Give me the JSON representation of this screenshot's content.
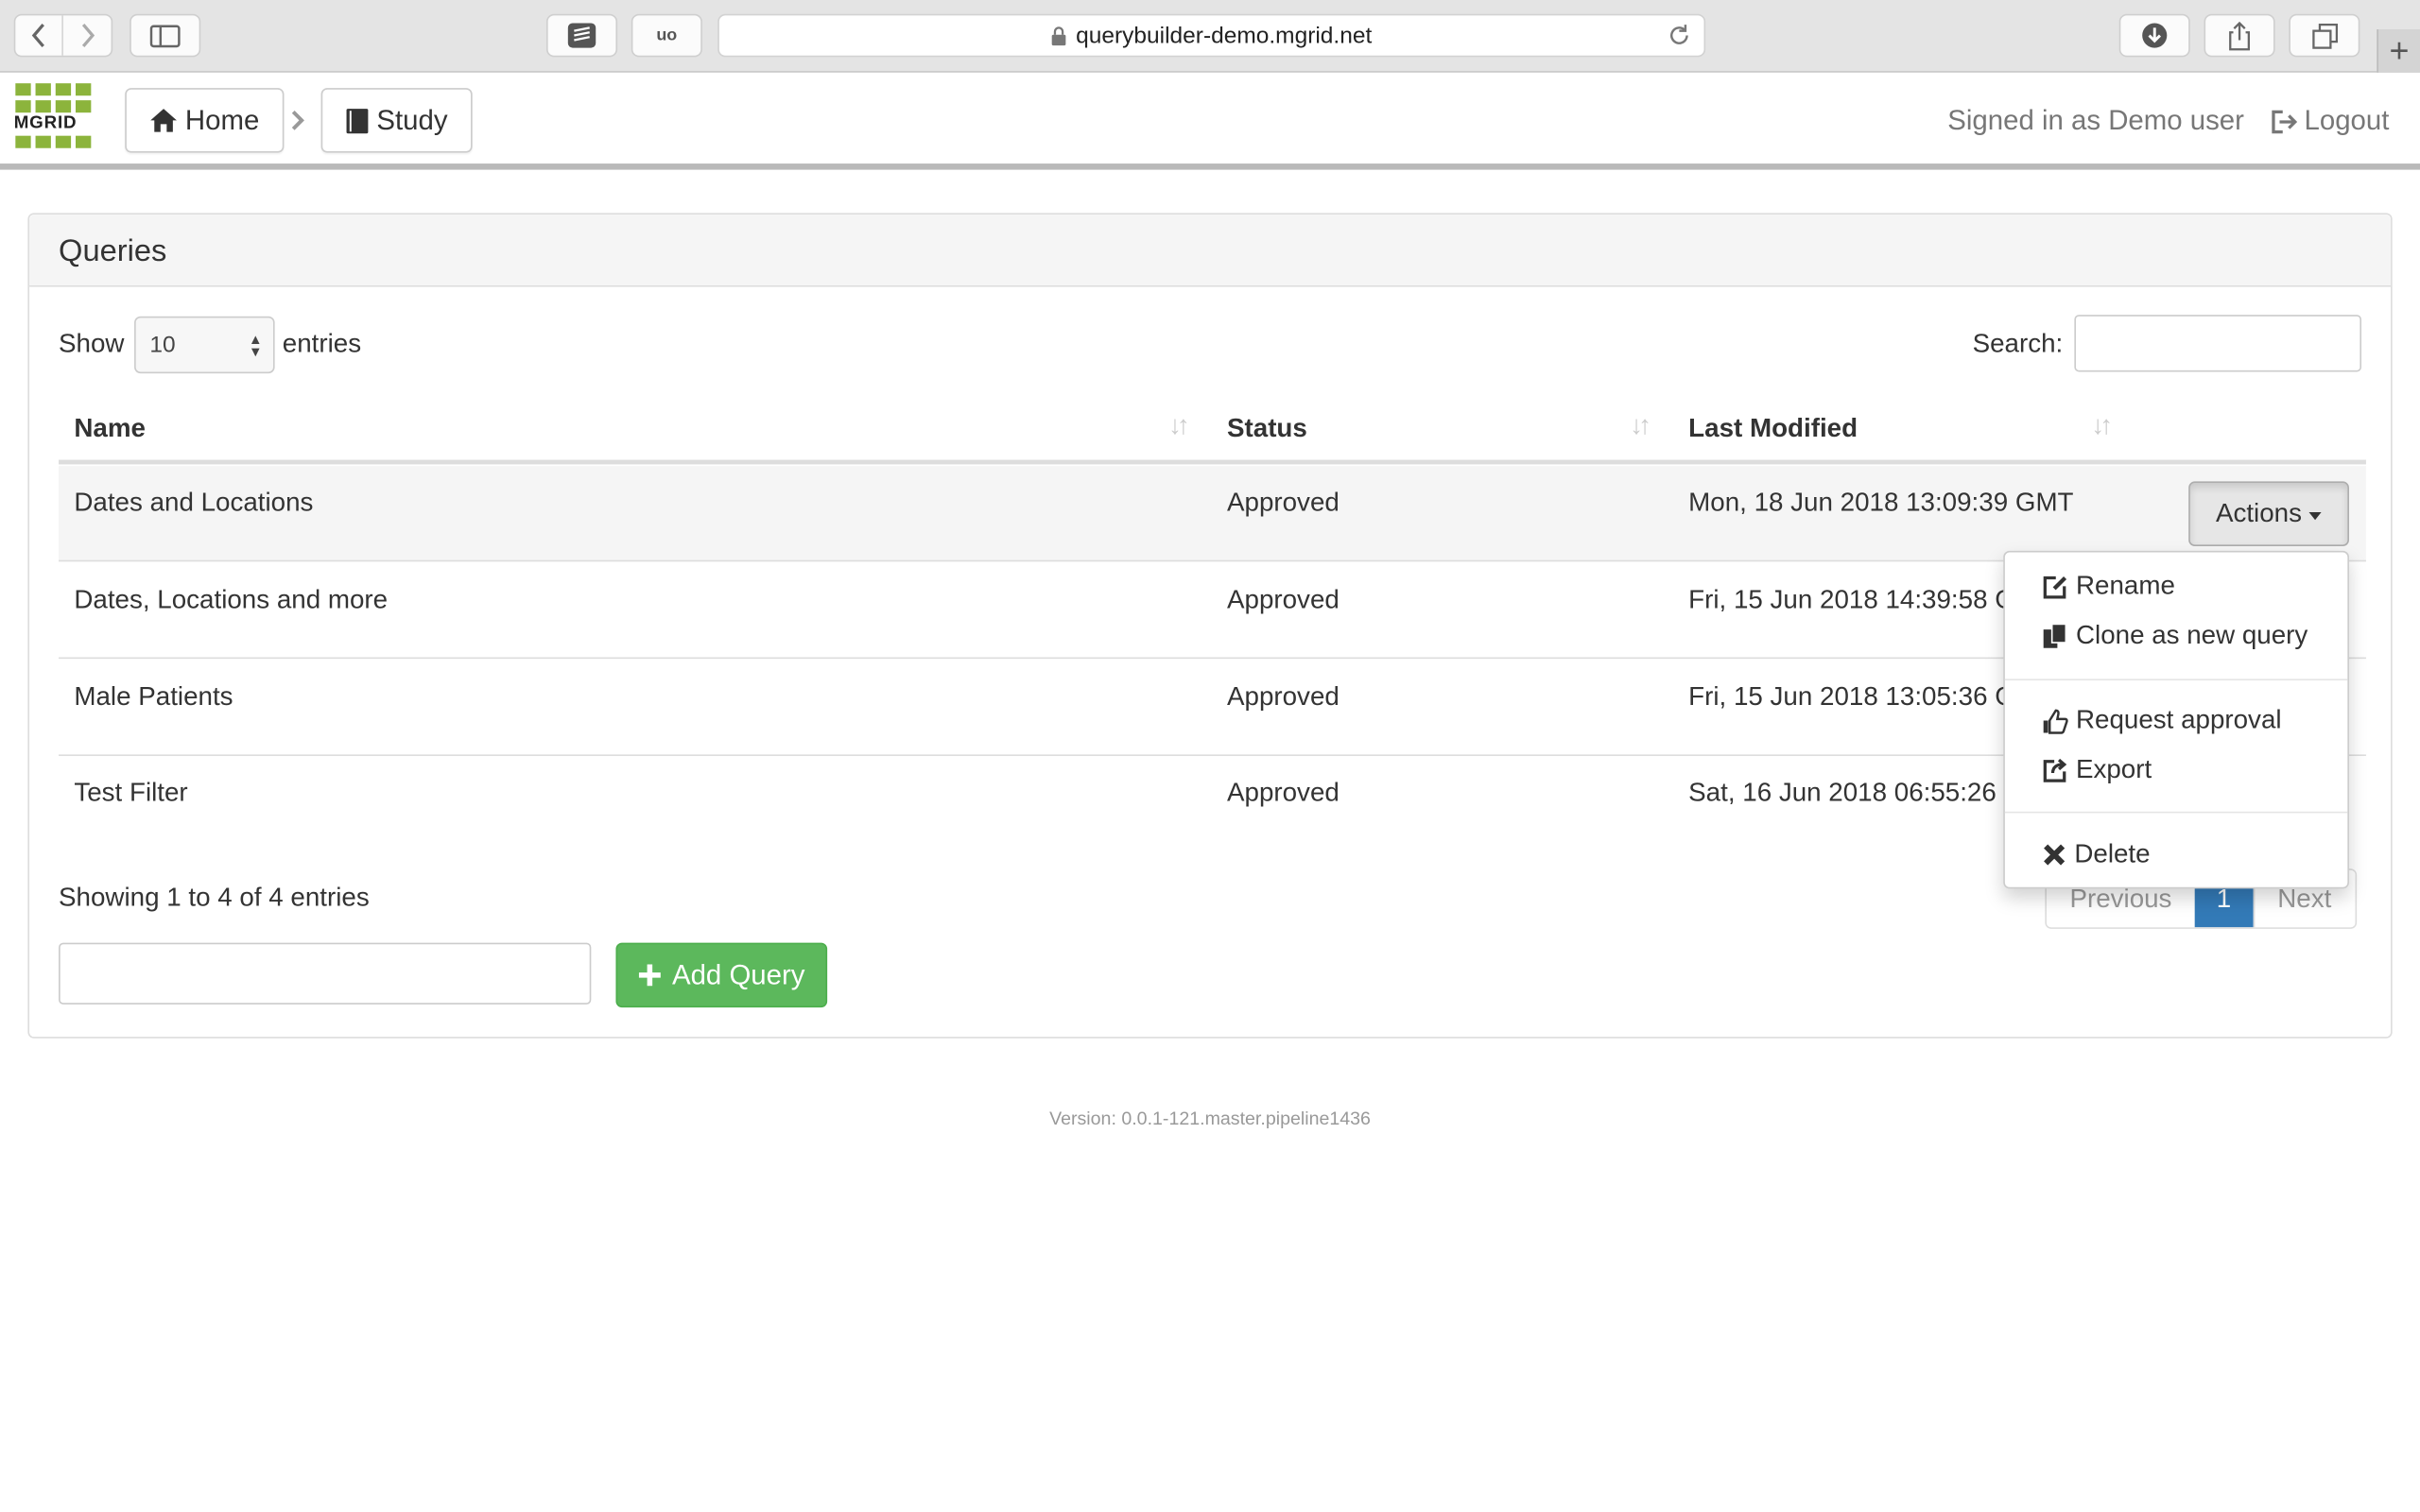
{
  "browser": {
    "url": "querybuilder-demo.mgrid.net",
    "new_tab_symbol": "+"
  },
  "navbar": {
    "logo_text": "MGRID",
    "logo_color": "#8cb43c",
    "home_label": "Home",
    "study_label": "Study",
    "signed_in_text": "Signed in as Demo user",
    "logout_label": "Logout"
  },
  "panel": {
    "title": "Queries",
    "show_label": "Show",
    "entries_label": "entries",
    "page_length": "10",
    "search_label": "Search:",
    "search_value": ""
  },
  "table": {
    "columns": [
      "Name",
      "Status",
      "Last Modified"
    ],
    "rows": [
      {
        "name": "Dates and Locations",
        "status": "Approved",
        "modified": "Mon, 18 Jun 2018 13:09:39 GMT"
      },
      {
        "name": "Dates, Locations and more",
        "status": "Approved",
        "modified": "Fri, 15 Jun 2018 14:39:58 G"
      },
      {
        "name": "Male Patients",
        "status": "Approved",
        "modified": "Fri, 15 Jun 2018 13:05:36 G"
      },
      {
        "name": "Test Filter",
        "status": "Approved",
        "modified": "Sat, 16 Jun 2018 06:55:26"
      }
    ],
    "actions_label": "Actions"
  },
  "dropdown": {
    "items": [
      "Rename",
      "Clone as new query",
      "Request approval",
      "Export",
      "Delete"
    ]
  },
  "footer_controls": {
    "info": "Showing 1 to 4 of 4 entries",
    "previous_label": "Previous",
    "current_page": "1",
    "next_label": "Next",
    "new_query_value": "",
    "add_query_label": "Add Query"
  },
  "version": "Version: 0.0.1-121.master.pipeline1436",
  "colors": {
    "primary": "#337ab7",
    "success": "#5cb85c"
  }
}
